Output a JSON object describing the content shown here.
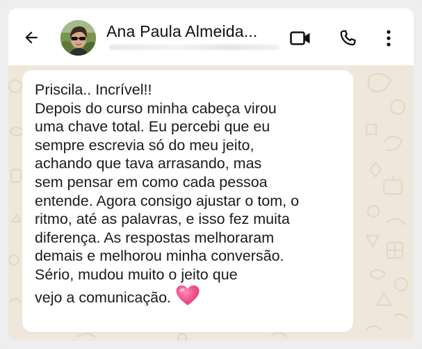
{
  "header": {
    "contact_name": "Ana Paula Almeida...",
    "icons": {
      "back": "arrow-left-icon",
      "video": "video-call-icon",
      "phone": "phone-icon",
      "menu": "more-vertical-icon"
    }
  },
  "message": {
    "lines": [
      "Priscila.. Incrível!!",
      "Depois do curso minha cabeça virou",
      "uma chave total. Eu percebi que eu",
      "sempre escrevia só do meu jeito,",
      "achando que tava arrasando, mas",
      "sem pensar em como cada pessoa",
      "entende. Agora consigo ajustar o tom, o",
      "ritmo, até as palavras, e isso fez muita",
      "diferença. As respostas melhoraram",
      "demais e melhorou minha conversão.",
      "Sério, mudou muito o jeito que",
      "vejo a comunicação."
    ],
    "emoji": "pink-heart-emoji"
  },
  "colors": {
    "header_bg": "#ffffff",
    "chat_bg": "#efe7dc",
    "bubble_bg": "#ffffff",
    "heart": "#f0508c"
  }
}
